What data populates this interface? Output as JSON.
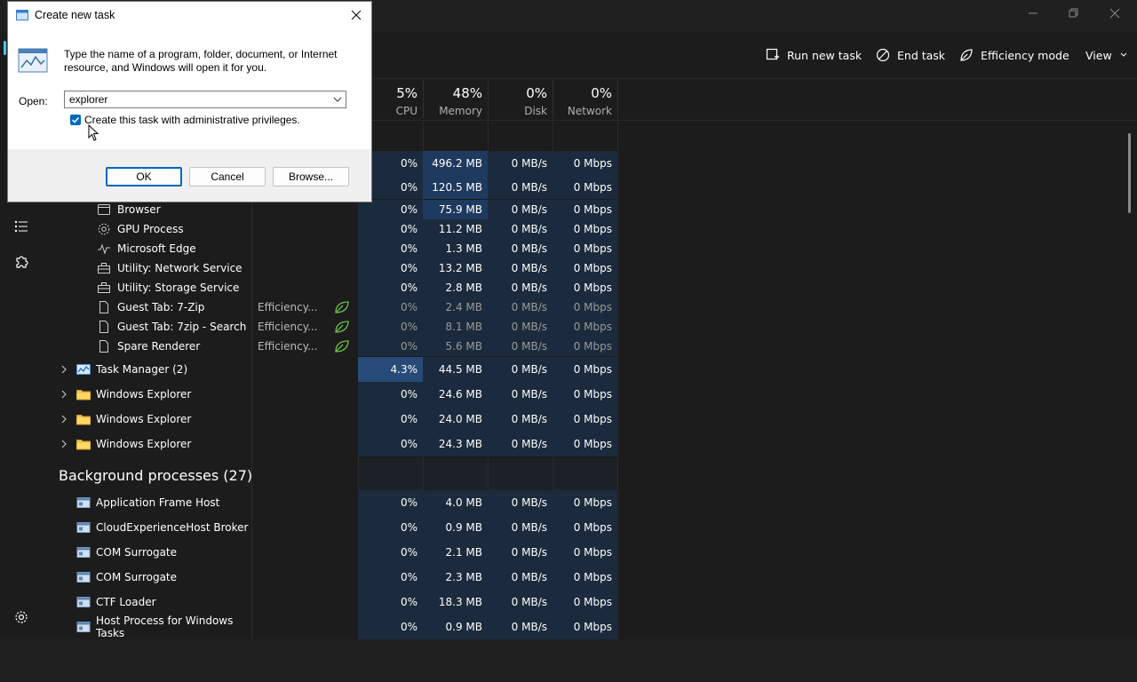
{
  "commands": {
    "run_new_task": "Run new task",
    "end_task": "End task",
    "efficiency_mode": "Efficiency mode",
    "view": "View"
  },
  "header": {
    "cpu": {
      "pct": "5%",
      "label": "CPU"
    },
    "memory": {
      "pct": "48%",
      "label": "Memory"
    },
    "disk": {
      "pct": "0%",
      "label": "Disk"
    },
    "network": {
      "pct": "0%",
      "label": "Network"
    }
  },
  "rows_top": [
    {
      "cpu": "0%",
      "mem": "496.2 MB",
      "disk": "0 MB/s",
      "net": "0 Mbps"
    },
    {
      "cpu": "0%",
      "mem": "120.5 MB",
      "disk": "0 MB/s",
      "net": "0 Mbps"
    }
  ],
  "edge_children": [
    {
      "name": "Browser",
      "icon": "browser-window-icon",
      "status": "",
      "cpu": "0%",
      "mem": "75.9 MB",
      "disk": "0 MB/s",
      "net": "0 Mbps"
    },
    {
      "name": "GPU Process",
      "icon": "gear-cog-icon",
      "status": "",
      "cpu": "0%",
      "mem": "11.2 MB",
      "disk": "0 MB/s",
      "net": "0 Mbps"
    },
    {
      "name": "Microsoft Edge",
      "icon": "pulse-icon",
      "status": "",
      "cpu": "0%",
      "mem": "1.3 MB",
      "disk": "0 MB/s",
      "net": "0 Mbps"
    },
    {
      "name": "Utility: Network Service",
      "icon": "toolbox-icon",
      "status": "",
      "cpu": "0%",
      "mem": "13.2 MB",
      "disk": "0 MB/s",
      "net": "0 Mbps"
    },
    {
      "name": "Utility: Storage Service",
      "icon": "toolbox-icon",
      "status": "",
      "cpu": "0%",
      "mem": "2.8 MB",
      "disk": "0 MB/s",
      "net": "0 Mbps"
    },
    {
      "name": "Guest Tab: 7-Zip",
      "icon": "page-icon",
      "status": "Efficiency...",
      "cpu": "0%",
      "mem": "2.4 MB",
      "disk": "0 MB/s",
      "net": "0 Mbps"
    },
    {
      "name": "Guest Tab: 7zip - Search",
      "icon": "page-icon",
      "status": "Efficiency...",
      "cpu": "0%",
      "mem": "8.1 MB",
      "disk": "0 MB/s",
      "net": "0 Mbps"
    },
    {
      "name": "Spare Renderer",
      "icon": "page-icon",
      "status": "Efficiency...",
      "cpu": "0%",
      "mem": "5.6 MB",
      "disk": "0 MB/s",
      "net": "0 Mbps"
    }
  ],
  "apps": [
    {
      "name": "Task Manager (2)",
      "icon": "task-manager-icon",
      "cpu": "4.3%",
      "mem": "44.5 MB",
      "disk": "0 MB/s",
      "net": "0 Mbps"
    },
    {
      "name": "Windows Explorer",
      "icon": "folder-icon",
      "cpu": "0%",
      "mem": "24.6 MB",
      "disk": "0 MB/s",
      "net": "0 Mbps"
    },
    {
      "name": "Windows Explorer",
      "icon": "folder-icon",
      "cpu": "0%",
      "mem": "24.0 MB",
      "disk": "0 MB/s",
      "net": "0 Mbps"
    },
    {
      "name": "Windows Explorer",
      "icon": "folder-icon",
      "cpu": "0%",
      "mem": "24.3 MB",
      "disk": "0 MB/s",
      "net": "0 Mbps"
    }
  ],
  "background": {
    "title": "Background processes (27)",
    "rows": [
      {
        "name": "Application Frame Host",
        "cpu": "0%",
        "mem": "4.0 MB",
        "disk": "0 MB/s",
        "net": "0 Mbps"
      },
      {
        "name": "CloudExperienceHost Broker",
        "cpu": "0%",
        "mem": "0.9 MB",
        "disk": "0 MB/s",
        "net": "0 Mbps"
      },
      {
        "name": "COM Surrogate",
        "cpu": "0%",
        "mem": "2.1 MB",
        "disk": "0 MB/s",
        "net": "0 Mbps"
      },
      {
        "name": "COM Surrogate",
        "cpu": "0%",
        "mem": "2.3 MB",
        "disk": "0 MB/s",
        "net": "0 Mbps"
      },
      {
        "name": "CTF Loader",
        "cpu": "0%",
        "mem": "18.3 MB",
        "disk": "0 MB/s",
        "net": "0 Mbps"
      },
      {
        "name": "Host Process for Windows Tasks",
        "cpu": "0%",
        "mem": "0.9 MB",
        "disk": "0 MB/s",
        "net": "0 Mbps"
      }
    ]
  },
  "dialog": {
    "title": "Create new task",
    "description": "Type the name of a program, folder, document, or Internet resource, and Windows will open it for you.",
    "open_label": "Open:",
    "open_value": "explorer",
    "admin_checkbox_label": "Create this task with administrative privileges.",
    "admin_checked": true,
    "ok": "OK",
    "cancel": "Cancel",
    "browse": "Browse..."
  },
  "colors": {
    "accent": "#0067c0",
    "heat_low": "#1b2a3d",
    "heat_mid": "#1f3a5f",
    "heat_high": "#274a78",
    "efficiency_leaf": "#6cc24a"
  }
}
